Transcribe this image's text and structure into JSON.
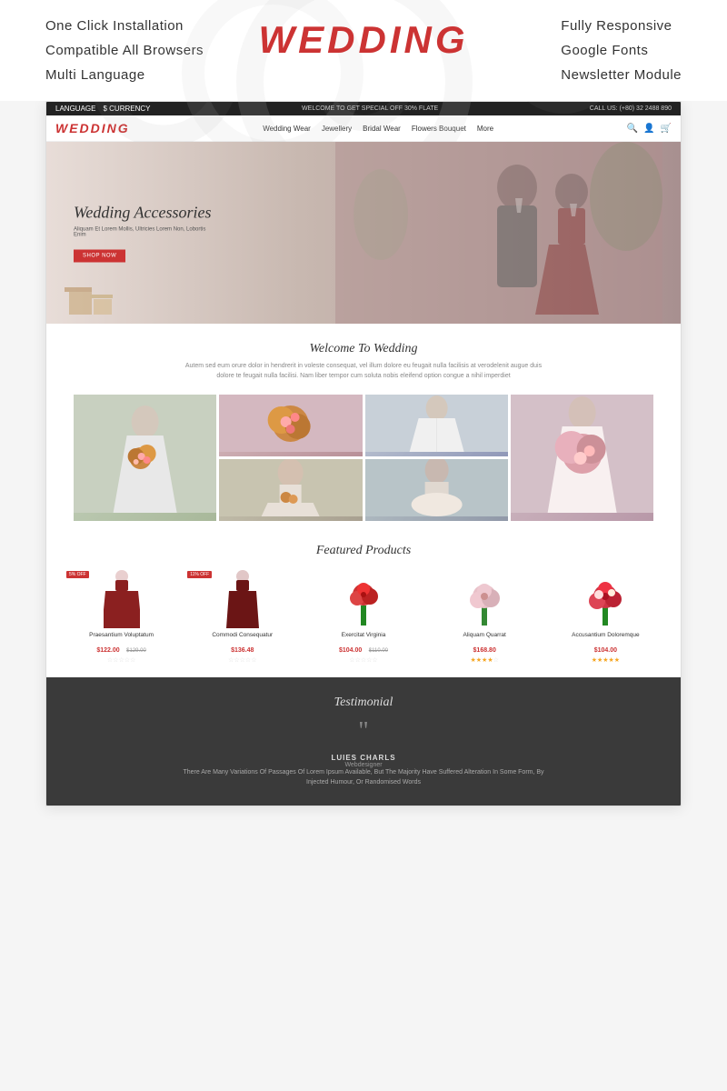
{
  "features": {
    "left": [
      "One Click Installation",
      "Compatible All Browsers",
      "Multi Language"
    ],
    "right": [
      "Fully Responsive",
      "Google Fonts",
      "Newsletter Module"
    ]
  },
  "logo": {
    "text": "WEDDING"
  },
  "store": {
    "topbar": {
      "language": "LANGUAGE",
      "currency": "$ CURRENCY",
      "promo": "WELCOME TO GET SPECIAL OFF 30% FLATE",
      "phone": "CALL US: (+80) 32 2488 890"
    },
    "nav": {
      "logo": "WEDDING",
      "menu": [
        "Wedding Wear",
        "Jewellery",
        "Bridal Wear",
        "Flowers Bouquet",
        "More"
      ]
    },
    "hero": {
      "title": "Wedding Accessories",
      "subtitle": "Aliquam Et Lorem Mollis, Ultricies Lorem Non, Lobortis Enim",
      "button": "SHOP NOW"
    },
    "welcome": {
      "title": "Welcome To Wedding",
      "text": "Autem sed eum orure dolor in hendrerit in voleste consequat, vel illum dolore eu feugait nulla facilisis at verodelenit augue duis dolore te feugait nulla facilisi. Nam liber tempor cum soluta nobis eleifend option congue a nihil imperdiet"
    },
    "featured": {
      "title": "Featured Products",
      "products": [
        {
          "name": "Praesantium Voluptatum",
          "price": "$122.00",
          "old_price": "$129.00",
          "badge": "5% OFF",
          "stars": 0,
          "type": "dress1"
        },
        {
          "name": "Commodi Consequatur",
          "price": "$136.48",
          "old_price": "",
          "badge": "11% OFF",
          "stars": 0,
          "type": "dress2"
        },
        {
          "name": "Exercitat Virginia",
          "price": "$104.00",
          "old_price": "$110.00",
          "badge": "",
          "stars": 0,
          "type": "flower1"
        },
        {
          "name": "Aliquam Quarrat",
          "price": "$168.80",
          "old_price": "",
          "badge": "",
          "stars": 4,
          "type": "flower2"
        },
        {
          "name": "Accusantium Doloremque",
          "price": "$104.00",
          "old_price": "",
          "badge": "",
          "stars": 5,
          "type": "flower3"
        }
      ]
    },
    "testimonial": {
      "title": "Testimonial",
      "author": "LUIES CHARLS",
      "role": "Webdesigner",
      "text": "There Are Many Variations Of Passages Of Lorem Ipsum Available, But The Majority Have Suffered Alteration In Some Form, By Injected Humour, Or Randomised Words"
    }
  }
}
